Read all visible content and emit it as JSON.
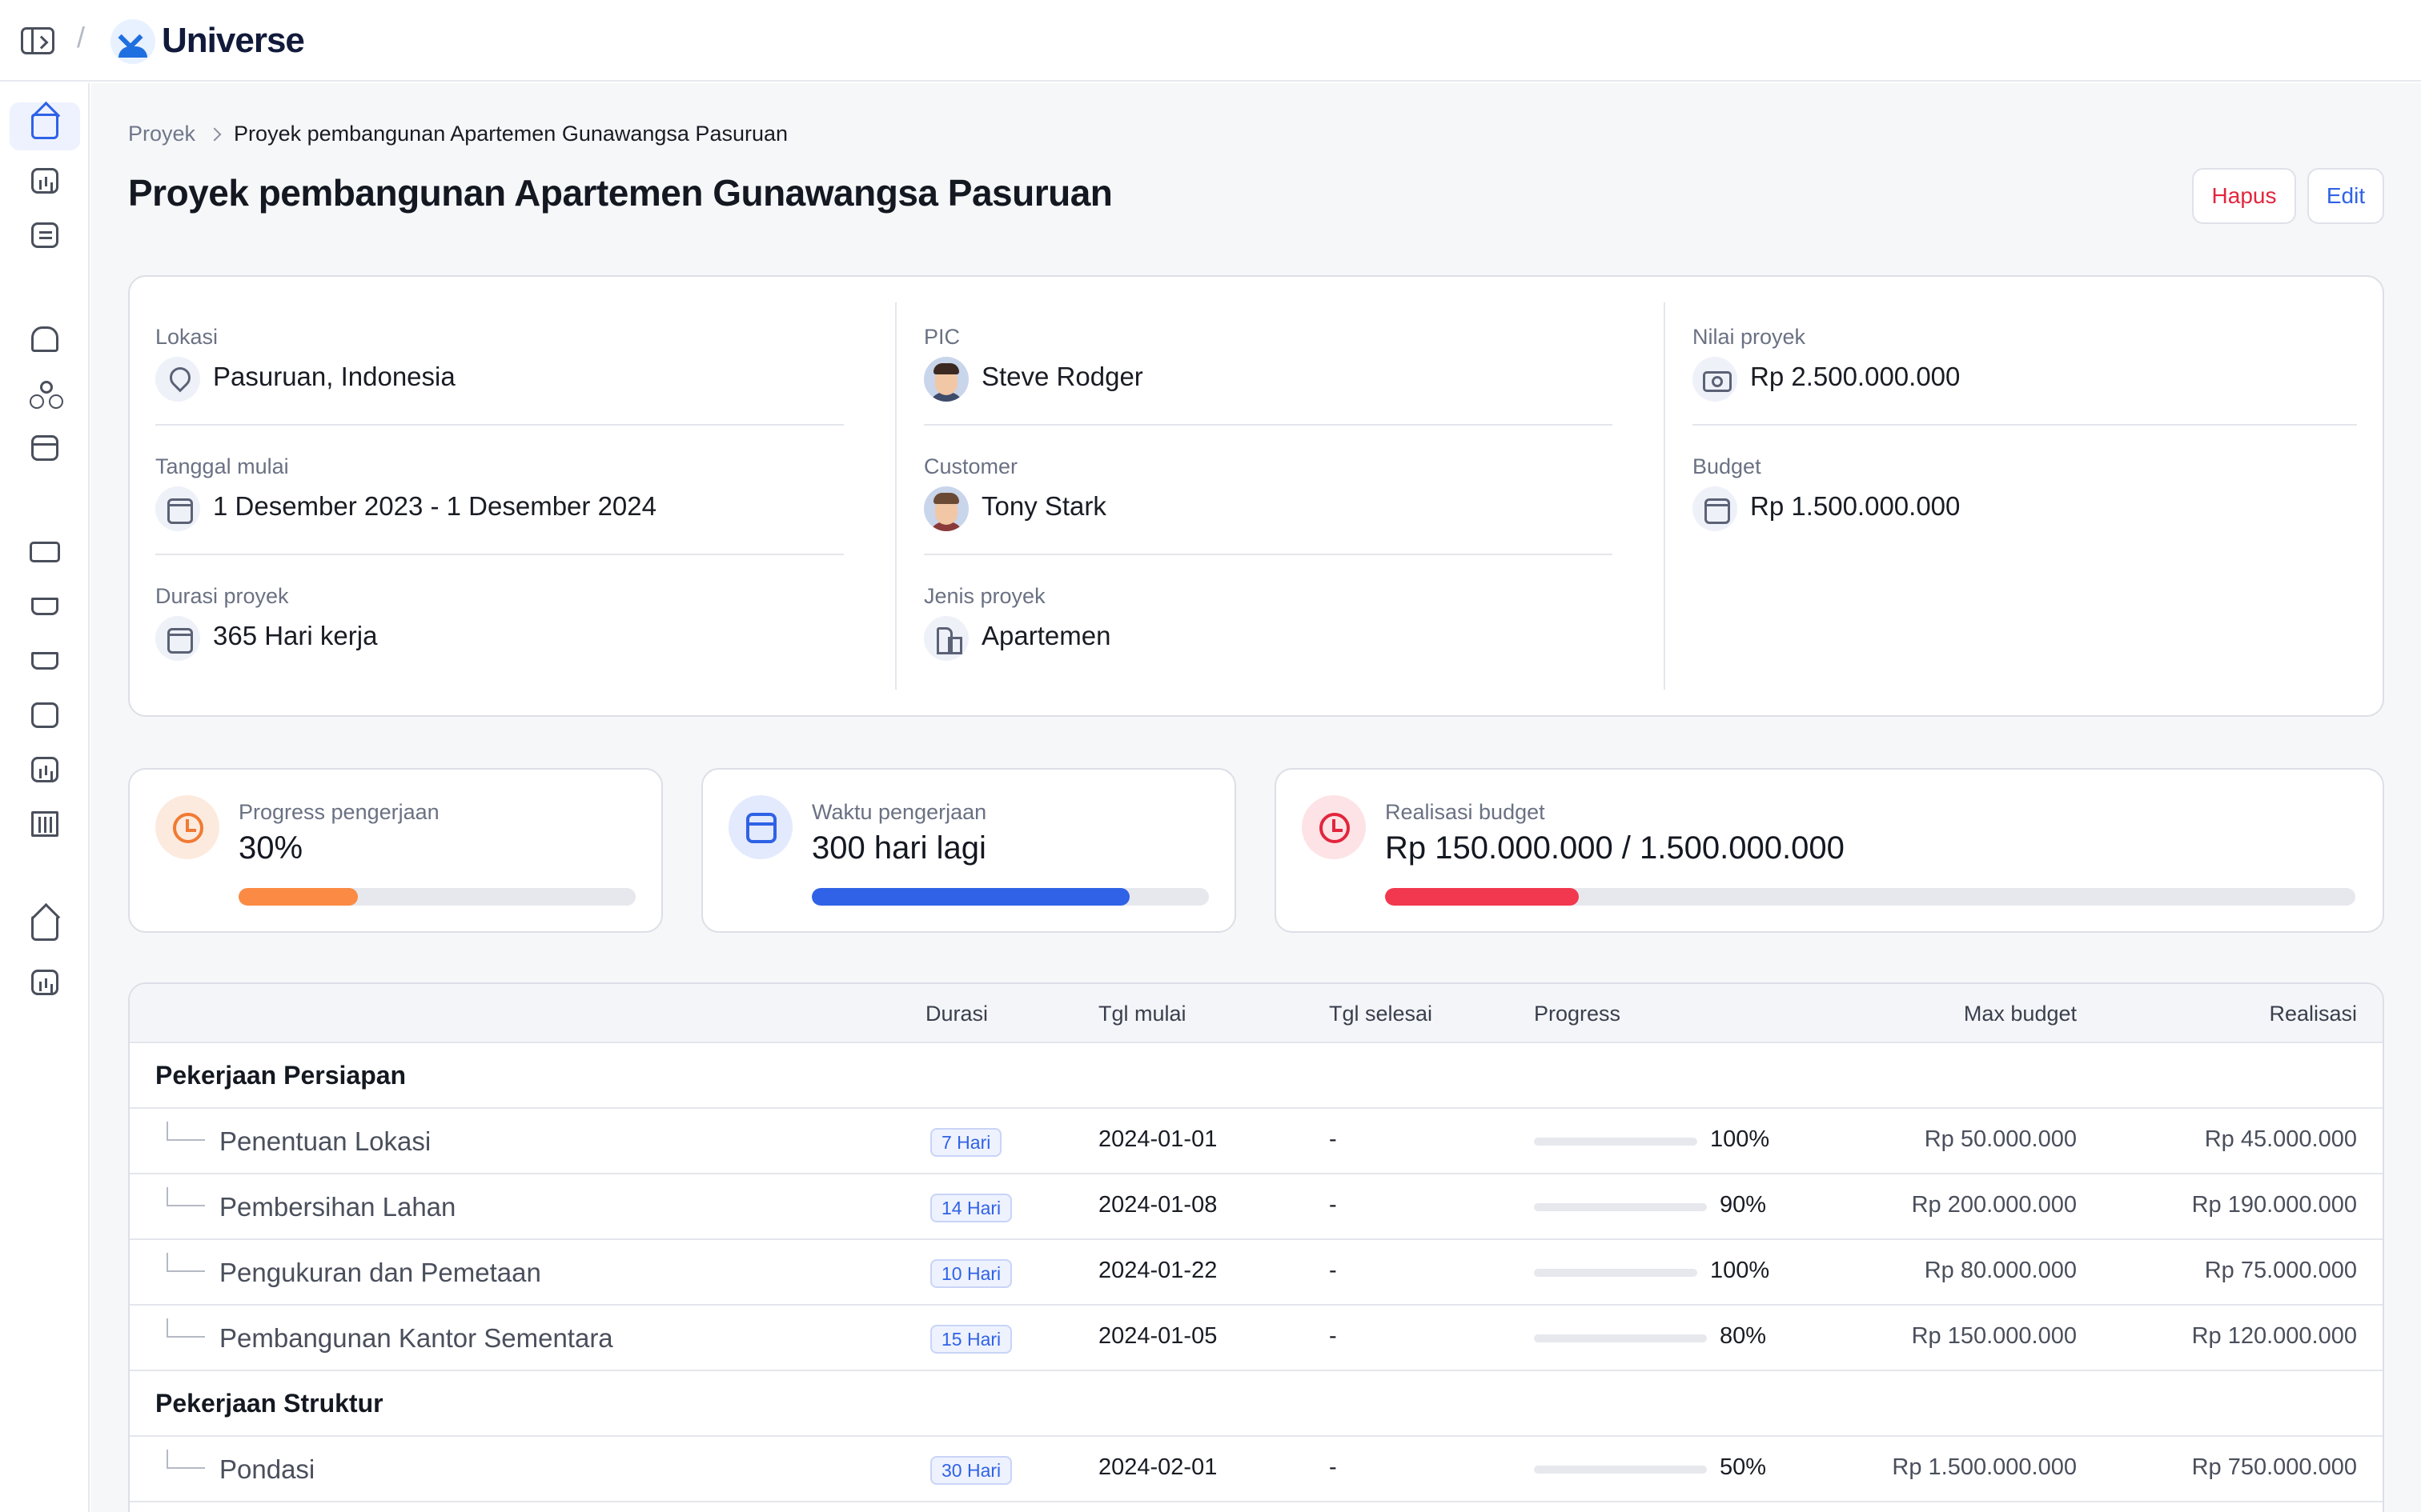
{
  "app": {
    "brand": "Universe"
  },
  "breadcrumb": {
    "parent": "Proyek",
    "current": "Proyek pembangunan Apartemen Gunawangsa Pasuruan"
  },
  "page_title": "Proyek pembangunan Apartemen Gunawangsa Pasuruan",
  "actions": {
    "delete_label": "Hapus",
    "edit_label": "Edit"
  },
  "info": {
    "lokasi": {
      "label": "Lokasi",
      "value": "Pasuruan, Indonesia"
    },
    "tanggal_mulai": {
      "label": "Tanggal mulai",
      "value": "1 Desember 2023 - 1 Desember 2024"
    },
    "durasi": {
      "label": "Durasi proyek",
      "value": "365 Hari kerja"
    },
    "pic": {
      "label": "PIC",
      "value": "Steve Rodger"
    },
    "customer": {
      "label": "Customer",
      "value": "Tony Stark"
    },
    "jenis": {
      "label": "Jenis proyek",
      "value": "Apartemen"
    },
    "nilai": {
      "label": "Nilai proyek",
      "value": "Rp 2.500.000.000"
    },
    "budget": {
      "label": "Budget",
      "value": "Rp 1.500.000.000"
    }
  },
  "stats": {
    "progress": {
      "label": "Progress pengerjaan",
      "value": "30%",
      "fraction": 0.3,
      "color": "#fb8a44"
    },
    "waktu": {
      "label": "Waktu pengerjaan",
      "value": "300 hari lagi",
      "fraction": 0.8,
      "color": "#2f62e6"
    },
    "realisasi": {
      "label": "Realisasi budget",
      "value": "Rp 150.000.000 / 1.500.000.000",
      "fraction": 0.2,
      "color": "#f2384e"
    }
  },
  "table": {
    "headers": {
      "durasi": "Durasi",
      "tgl_mulai": "Tgl mulai",
      "tgl_selesai": "Tgl selesai",
      "progress": "Progress",
      "max_budget": "Max budget",
      "realisasi": "Realisasi"
    },
    "groups": [
      {
        "name": "Pekerjaan Persiapan",
        "rows": [
          {
            "name": "Penentuan Lokasi",
            "durasi": "7 Hari",
            "tgl_mulai": "2024-01-01",
            "tgl_selesai": "-",
            "progress": "100%",
            "max_budget": "Rp 50.000.000",
            "realisasi": "Rp 45.000.000"
          },
          {
            "name": "Pembersihan Lahan",
            "durasi": "14 Hari",
            "tgl_mulai": "2024-01-08",
            "tgl_selesai": "-",
            "progress": "90%",
            "max_budget": "Rp 200.000.000",
            "realisasi": "Rp 190.000.000"
          },
          {
            "name": "Pengukuran dan Pemetaan",
            "durasi": "10 Hari",
            "tgl_mulai": "2024-01-22",
            "tgl_selesai": "-",
            "progress": "100%",
            "max_budget": "Rp 80.000.000",
            "realisasi": "Rp 75.000.000"
          },
          {
            "name": "Pembangunan Kantor Sementara",
            "durasi": "15 Hari",
            "tgl_mulai": "2024-01-05",
            "tgl_selesai": "-",
            "progress": "80%",
            "max_budget": "Rp 150.000.000",
            "realisasi": "Rp 120.000.000"
          }
        ]
      },
      {
        "name": "Pekerjaan Struktur",
        "rows": [
          {
            "name": "Pondasi",
            "durasi": "30 Hari",
            "tgl_mulai": "2024-02-01",
            "tgl_selesai": "-",
            "progress": "50%",
            "max_budget": "Rp 1.500.000.000",
            "realisasi": "Rp 750.000.000"
          }
        ]
      }
    ]
  },
  "sidebar": {
    "icons": [
      "home-icon",
      "analytics-icon",
      "notes-icon",
      "service-bell-icon",
      "org-chart-icon",
      "window-icon",
      "truck-icon",
      "cart-icon",
      "cart-add-icon",
      "train-icon",
      "factory-icon",
      "bank-icon",
      "home-icon",
      "analytics-icon"
    ]
  }
}
